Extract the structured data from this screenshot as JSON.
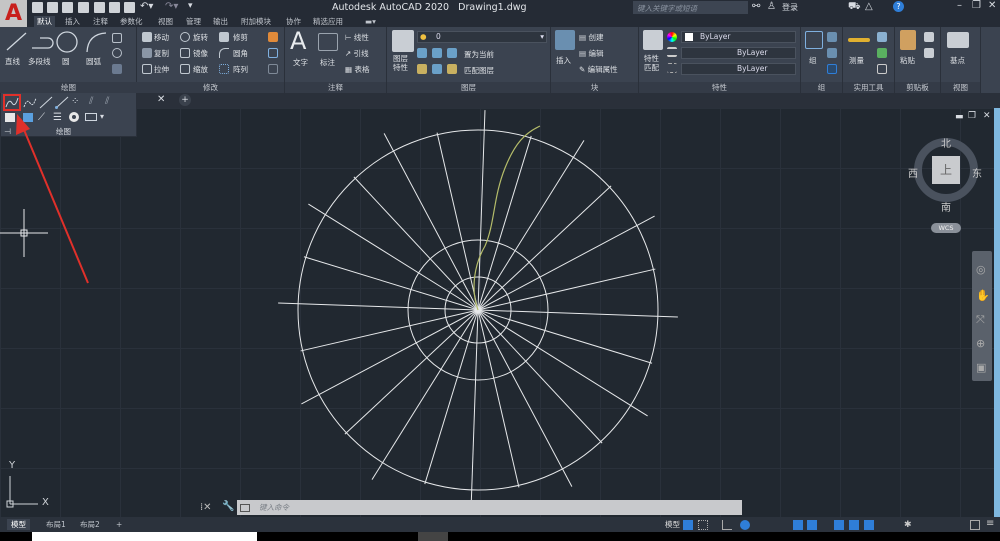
{
  "app": {
    "logo": "A",
    "title": "Autodesk AutoCAD 2020",
    "file": "Drawing1.dwg"
  },
  "search": {
    "placeholder": "键入关键字或短语"
  },
  "account": {
    "login": "登录"
  },
  "tabs": [
    "默认",
    "插入",
    "注释",
    "参数化",
    "视图",
    "管理",
    "输出",
    "附加模块",
    "协作",
    "精选应用"
  ],
  "ribbon": {
    "draw": {
      "items": [
        "直线",
        "多段线",
        "圆",
        "圆弧"
      ],
      "title": "绘图"
    },
    "modify": {
      "items": [
        "移动",
        "旋转",
        "修剪",
        "复制",
        "镜像",
        "圆角",
        "拉伸",
        "缩放",
        "阵列"
      ],
      "title": "修改"
    },
    "annotation": {
      "items": [
        "文字",
        "标注",
        "线性",
        "引线",
        "表格"
      ],
      "title": "注释"
    },
    "layers": {
      "items": [
        "图层特性",
        "置为当前",
        "匹配图层"
      ],
      "layer_value": "0",
      "title": "图层"
    },
    "block": {
      "items": [
        "插入",
        "创建",
        "编辑",
        "编辑属性"
      ],
      "title": "块"
    },
    "properties": {
      "match": "特性匹配",
      "color": "ByLayer",
      "linetype": "ByLayer",
      "lineweight": "ByLayer",
      "title": "特性"
    },
    "groups": {
      "items": [
        "组"
      ],
      "title": "组"
    },
    "utilities": {
      "items": [
        "测量"
      ],
      "title": "实用工具"
    },
    "clipboard": {
      "items": [
        "粘贴"
      ],
      "title": "剪贴板"
    },
    "view": {
      "items": [
        "基点"
      ],
      "title": "视图"
    }
  },
  "flyout": {
    "title": "绘图"
  },
  "viewcube": {
    "north": "北",
    "south": "南",
    "east": "东",
    "west": "西",
    "face": "上",
    "wcs": "WCS"
  },
  "ucs": {
    "x": "X",
    "y": "Y"
  },
  "command": {
    "placeholder": "键入命令"
  },
  "layout_tabs": [
    "模型",
    "布局1",
    "布局2"
  ],
  "status": {
    "model": "模型"
  },
  "colors": {
    "accent": "#c8201c",
    "highlight": "#e0302a",
    "spline": "#b5bd6a",
    "geometry": "#e6e8ea"
  }
}
